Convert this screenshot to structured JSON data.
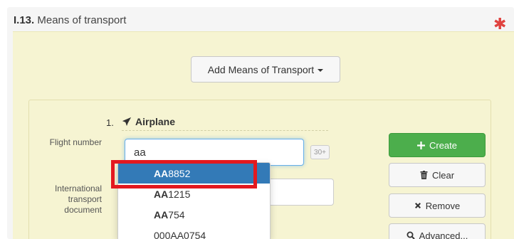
{
  "panel": {
    "section_number": "I.13.",
    "section_title": " Means of transport",
    "required_mark": "✱"
  },
  "add_button": {
    "label": "Add Means of Transport"
  },
  "transport": {
    "index": "1.",
    "type": "Airplane"
  },
  "fields": {
    "flight_number_label": "Flight number",
    "flight_number_value": "aa",
    "char_counter": "30+",
    "intl_doc_label": "International transport document"
  },
  "actions": {
    "create": "Create",
    "clear": "Clear",
    "remove": "Remove",
    "advanced": "Advanced..."
  },
  "autocomplete": [
    {
      "match": "AA",
      "rest": "8852"
    },
    {
      "match": "AA",
      "rest": "1215"
    },
    {
      "match": "AA",
      "rest": "754"
    },
    {
      "match": "",
      "rest": "000AA0754"
    }
  ],
  "colors": {
    "accent": "#337ab7",
    "create_green": "#4cae4c",
    "highlight_red": "#e3191f",
    "panel_yellow": "#f6f4d2"
  }
}
